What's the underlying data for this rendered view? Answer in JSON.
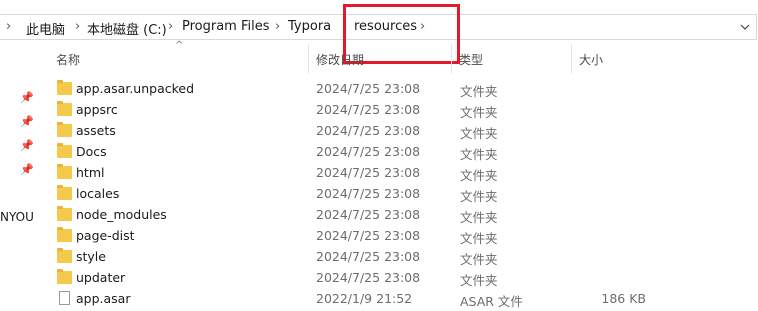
{
  "breadcrumb": [
    "此电脑",
    "本地磁盘 (C:)",
    "Program Files",
    "Typora",
    "resources"
  ],
  "columns": {
    "name": "名称",
    "modified": "修改日期",
    "type": "类型",
    "size": "大小"
  },
  "nav": {
    "partial_label": "NYOU"
  },
  "colors": {
    "folder": "#f5c94b",
    "highlight": "#e3192b"
  },
  "rows": [
    {
      "icon": "folder-icon",
      "name": "app.asar.unpacked",
      "modified": "2024/7/25 23:08",
      "type": "文件夹",
      "size": ""
    },
    {
      "icon": "folder-icon",
      "name": "appsrc",
      "modified": "2024/7/25 23:08",
      "type": "文件夹",
      "size": ""
    },
    {
      "icon": "folder-icon",
      "name": "assets",
      "modified": "2024/7/25 23:08",
      "type": "文件夹",
      "size": ""
    },
    {
      "icon": "folder-icon",
      "name": "Docs",
      "modified": "2024/7/25 23:08",
      "type": "文件夹",
      "size": ""
    },
    {
      "icon": "folder-icon",
      "name": "html",
      "modified": "2024/7/25 23:08",
      "type": "文件夹",
      "size": ""
    },
    {
      "icon": "folder-icon",
      "name": "locales",
      "modified": "2024/7/25 23:08",
      "type": "文件夹",
      "size": ""
    },
    {
      "icon": "folder-icon",
      "name": "node_modules",
      "modified": "2024/7/25 23:08",
      "type": "文件夹",
      "size": ""
    },
    {
      "icon": "folder-icon",
      "name": "page-dist",
      "modified": "2024/7/25 23:08",
      "type": "文件夹",
      "size": ""
    },
    {
      "icon": "folder-icon",
      "name": "style",
      "modified": "2024/7/25 23:08",
      "type": "文件夹",
      "size": ""
    },
    {
      "icon": "folder-icon",
      "name": "updater",
      "modified": "2024/7/25 23:08",
      "type": "文件夹",
      "size": ""
    },
    {
      "icon": "file-icon",
      "name": "app.asar",
      "modified": "2022/1/9 21:52",
      "type": "ASAR 文件",
      "size": "186 KB"
    }
  ]
}
